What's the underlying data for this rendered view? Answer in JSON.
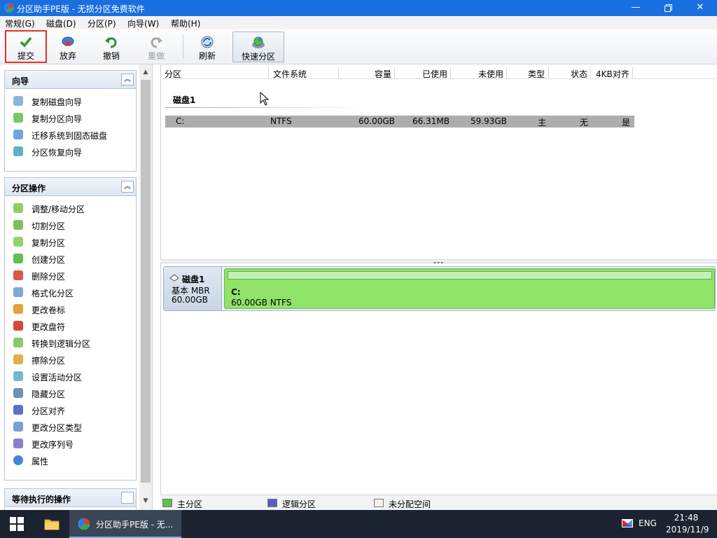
{
  "window": {
    "title": "分区助手PE版 - 无损分区免费软件"
  },
  "menu": [
    "常规(G)",
    "磁盘(D)",
    "分区(P)",
    "向导(W)",
    "帮助(H)"
  ],
  "toolbar": {
    "submit": "提交",
    "discard": "放弃",
    "undo": "撤销",
    "redo": "重做",
    "refresh": "刷新",
    "quick_partition": "快速分区"
  },
  "wizard": {
    "title": "向导",
    "items": [
      "复制磁盘向导",
      "复制分区向导",
      "迁移系统到固态磁盘",
      "分区恢复向导"
    ]
  },
  "partition_ops": {
    "title": "分区操作",
    "items": [
      "调整/移动分区",
      "切割分区",
      "复制分区",
      "创建分区",
      "删除分区",
      "格式化分区",
      "更改卷标",
      "更改盘符",
      "转换到逻辑分区",
      "擦除分区",
      "设置活动分区",
      "隐藏分区",
      "分区对齐",
      "更改分区类型",
      "更改序列号",
      "属性"
    ]
  },
  "pending": {
    "title": "等待执行的操作"
  },
  "list": {
    "columns": [
      "分区",
      "文件系统",
      "容量",
      "已使用",
      "未使用",
      "类型",
      "状态",
      "4KB对齐"
    ],
    "disk_title": "磁盘1",
    "row": {
      "partition": "C:",
      "fs": "NTFS",
      "capacity": "60.00GB",
      "used": "66.31MB",
      "free": "59.93GB",
      "type": "主",
      "status": "无",
      "align4k": "是"
    }
  },
  "diskmap": {
    "disk_name": "磁盘1",
    "disk_type": "基本 MBR",
    "disk_size": "60.00GB",
    "part_label": "C:",
    "part_desc": "60.00GB NTFS"
  },
  "legend": {
    "primary": "主分区",
    "logical": "逻辑分区",
    "unallocated": "未分配空间"
  },
  "taskbar": {
    "app_label": "分区助手PE版 - 无...",
    "lang": "ENG",
    "time": "21:48",
    "date": "2019/11/9"
  },
  "colors": {
    "titlebar": "#1a6fe0",
    "primary": "#8fe368",
    "logical": "#5a5ac8",
    "taskbar": "#1b2330"
  }
}
